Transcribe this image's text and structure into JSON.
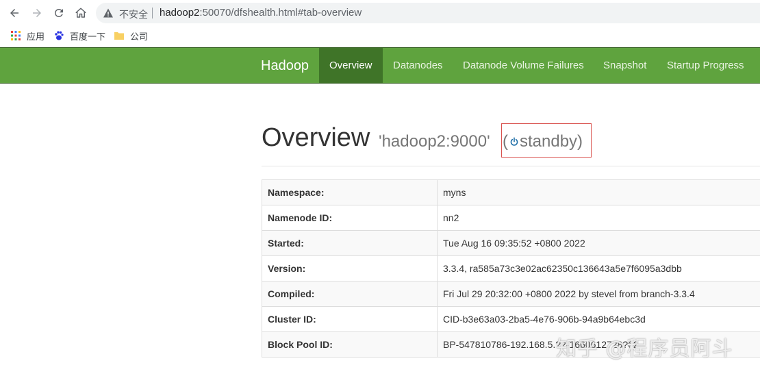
{
  "browser": {
    "security_label": "不安全",
    "url_host": "hadoop2",
    "url_rest": ":50070/dfshealth.html#tab-overview",
    "bookmarks": [
      {
        "label": "应用",
        "icon": "apps-grid-icon"
      },
      {
        "label": "百度一下",
        "icon": "baidu-paw-icon"
      },
      {
        "label": "公司",
        "icon": "folder-icon"
      }
    ]
  },
  "navbar": {
    "brand": "Hadoop",
    "items": [
      {
        "label": "Overview",
        "active": true
      },
      {
        "label": "Datanodes",
        "active": false
      },
      {
        "label": "Datanode Volume Failures",
        "active": false
      },
      {
        "label": "Snapshot",
        "active": false
      },
      {
        "label": "Startup Progress",
        "active": false
      }
    ],
    "color": "#5fa33e",
    "active_color": "#3f7428"
  },
  "page": {
    "heading": "Overview",
    "host": "'hadoop2:9000'",
    "state_open": "(",
    "state": "standby)",
    "highlight_color": "#d9534f"
  },
  "info_rows": [
    {
      "key": "Namespace:",
      "value": "myns"
    },
    {
      "key": "Namenode ID:",
      "value": "nn2"
    },
    {
      "key": "Started:",
      "value": "Tue Aug 16 09:35:52 +0800 2022"
    },
    {
      "key": "Version:",
      "value": "3.3.4, ra585a73c3e02ac62350c136643a5e7f6095a3dbb"
    },
    {
      "key": "Compiled:",
      "value": "Fri Jul 29 20:32:00 +0800 2022 by stevel from branch-3.3.4"
    },
    {
      "key": "Cluster ID:",
      "value": "CID-b3e63a03-2ba5-4e76-906b-94a9b64ebc3d"
    },
    {
      "key": "Block Pool ID:",
      "value": "BP-547810786-192.168.5.?2-1660612728?62"
    }
  ],
  "watermark": "知乎 @程序员阿斗"
}
